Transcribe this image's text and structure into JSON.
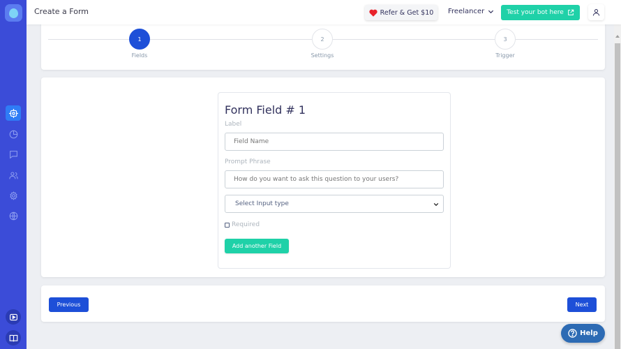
{
  "header": {
    "title": "Create a Form",
    "refer_label": "Refer & Get $10",
    "account_label": "Freelancer",
    "test_bot_label": "Test your bot here"
  },
  "stepper": {
    "steps": [
      {
        "number": "1",
        "label": "Fields",
        "active": true
      },
      {
        "number": "2",
        "label": "Settings",
        "active": false
      },
      {
        "number": "3",
        "label": "Trigger",
        "active": false
      }
    ]
  },
  "form_field": {
    "title": "Form Field # 1",
    "label_caption": "Label",
    "label_placeholder": "Field Name",
    "prompt_caption": "Prompt Phrase",
    "prompt_placeholder": "How do you want to ask this question to your users?",
    "input_type_selected": "Select Input type",
    "required_label": "Required",
    "required_checked": false,
    "add_field_label": "Add another Field"
  },
  "navigation": {
    "previous_label": "Previous",
    "next_label": "Next"
  },
  "help_label": "Help",
  "sidebar": {
    "icons": [
      "bot-icon",
      "chart-icon",
      "chat-icon",
      "users-icon",
      "settings-icon",
      "globe-icon"
    ],
    "bottom_icons": [
      "video-icon",
      "book-icon"
    ]
  },
  "colors": {
    "primary": "#1d4fd8",
    "sidebar": "#3b4cd8",
    "accent": "#1fd1a8",
    "help": "#2d6bb4"
  }
}
